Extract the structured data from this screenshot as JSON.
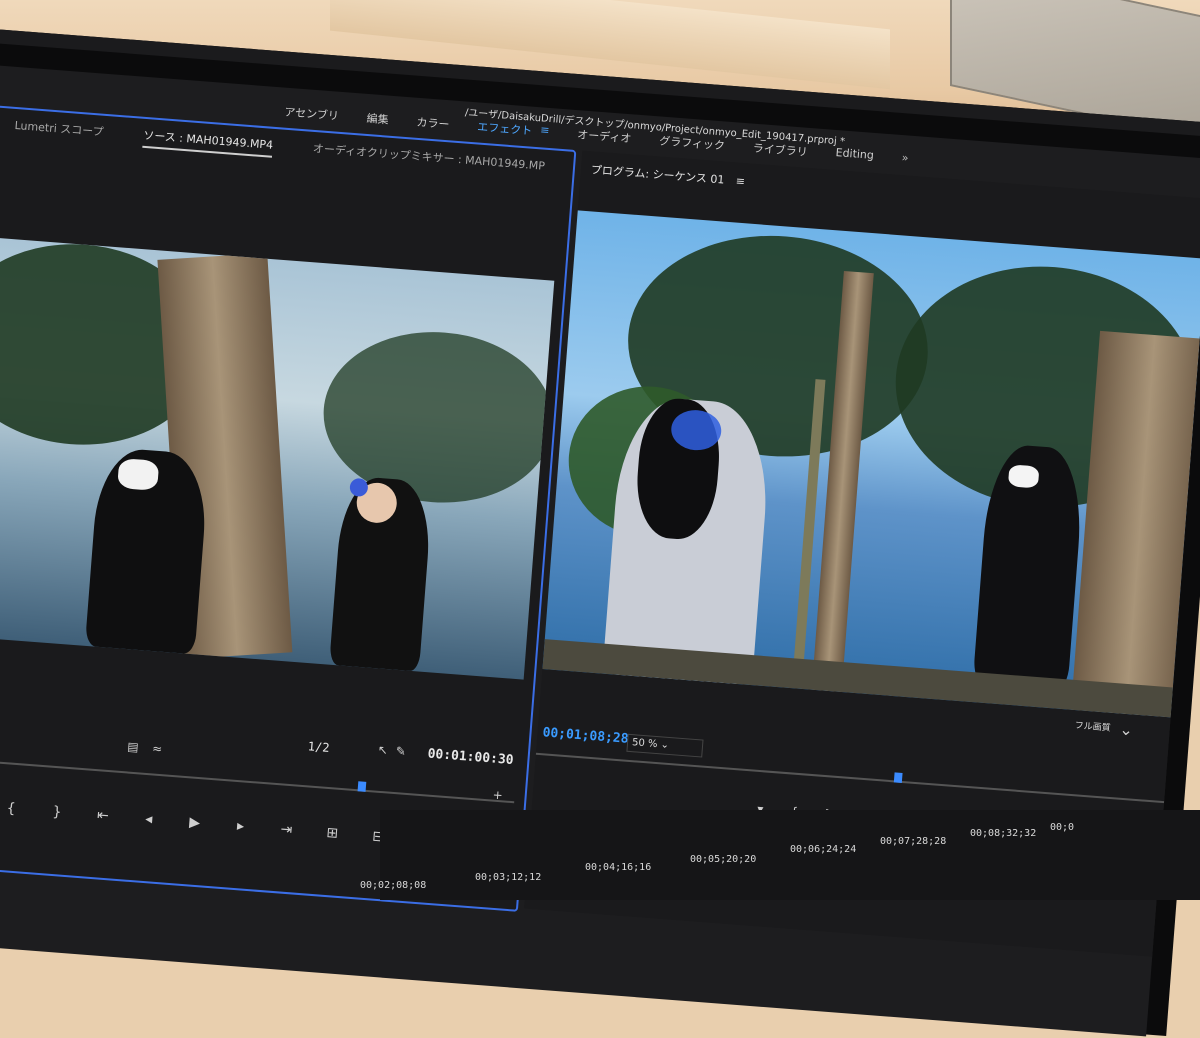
{
  "window": {
    "path": "/ユーザ/DaisakuDrill/デスクトップ/onmyo/Project/onmyo_Edit_190417.prproj *"
  },
  "workspaces": {
    "items": [
      "アセンブリ",
      "編集",
      "カラー",
      "エフェクト",
      "オーディオ",
      "グラフィック",
      "ライブラリ",
      "Editing"
    ],
    "active_index": 3,
    "overflow": "»",
    "menu_icon": "hamburger-icon"
  },
  "source_panel": {
    "tabs": [
      "Lumetri スコープ",
      "ソース : MAH01949.MP4",
      "オーディオクリップミキサー : MAH01949.MP"
    ],
    "active_tab_index": 1,
    "overflow": "»",
    "fraction": "1/2",
    "timecode": "00:01:00:30",
    "playhead_position": 0.73,
    "add_button": "+",
    "controls": [
      "marker-icon",
      "mark-in-icon",
      "mark-out-icon",
      "go-to-in-icon",
      "step-back-icon",
      "play-icon",
      "step-forward-icon",
      "go-to-out-icon",
      "insert-icon",
      "overwrite-icon",
      "camera-icon"
    ]
  },
  "program_panel": {
    "title": "プログラム: シーケンス 01",
    "timecode": "00;01;08;28",
    "zoom": "50 %",
    "quality": "フル画質",
    "playhead_position": 0.57,
    "controls": [
      "marker-icon",
      "mark-in-icon",
      "mark-out-icon",
      "go-to-in-icon",
      "step-back-icon",
      "play-icon",
      "step-forward-icon",
      "go-to-out-icon",
      "lift-icon",
      "extract-icon",
      "camera-icon"
    ]
  },
  "timeline": {
    "ticks": [
      "00;02;08;08",
      "00;03;12;12",
      "00;04;16;16",
      "00;05;20;20",
      "00;06;24;24",
      "00;07;28;28",
      "00;08;32;32",
      "00;0"
    ]
  }
}
